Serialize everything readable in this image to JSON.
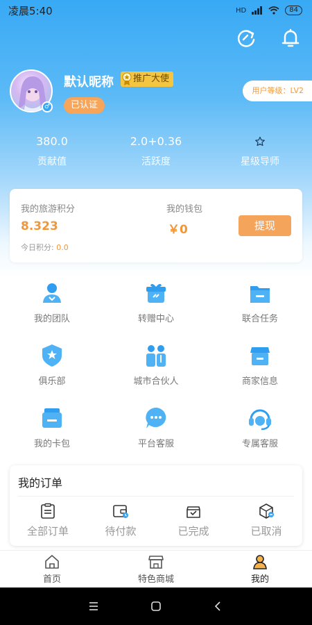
{
  "status_bar": {
    "time": "凌晨5:40",
    "network": "HD",
    "battery": "84"
  },
  "profile": {
    "nickname": "默认昵称",
    "badge": "推广大使",
    "verified": "已认证",
    "level": "用户等级：LV2"
  },
  "stats": [
    {
      "value": "380.0",
      "label": "贡献值"
    },
    {
      "value": "2.0+0.36",
      "label": "活跃度"
    },
    {
      "value": "",
      "label": "星级导师",
      "icon": "star-icon"
    }
  ],
  "points_card": {
    "points_label": "我的旅游积分",
    "points_value": "8.323",
    "wallet_label": "我的钱包",
    "wallet_value": "￥0",
    "today_label": "今日积分:",
    "today_value": "0.0",
    "withdraw_label": "提现"
  },
  "grid": [
    {
      "label": "我的团队",
      "icon": "team-icon"
    },
    {
      "label": "转赠中心",
      "icon": "gift-icon"
    },
    {
      "label": "联合任务",
      "icon": "folder-icon"
    },
    {
      "label": "俱乐部",
      "icon": "shield-star-icon"
    },
    {
      "label": "城市合伙人",
      "icon": "partners-icon"
    },
    {
      "label": "商家信息",
      "icon": "store-icon"
    },
    {
      "label": "我的卡包",
      "icon": "card-wallet-icon"
    },
    {
      "label": "平台客服",
      "icon": "chat-icon"
    },
    {
      "label": "专属客服",
      "icon": "headset-icon"
    }
  ],
  "orders": {
    "title": "我的订单",
    "items": [
      {
        "label": "全部订单",
        "icon": "clipboard-icon"
      },
      {
        "label": "待付款",
        "icon": "wallet-clock-icon"
      },
      {
        "label": "已完成",
        "icon": "box-check-icon"
      },
      {
        "label": "已取消",
        "icon": "box-cancel-icon"
      }
    ]
  },
  "tabbar": [
    {
      "label": "首页",
      "icon": "home-icon",
      "active": false
    },
    {
      "label": "特色商城",
      "icon": "shop-icon",
      "active": false
    },
    {
      "label": "我的",
      "icon": "user-icon",
      "active": true
    }
  ],
  "colors": {
    "primary": "#3aa4f0",
    "accent": "#f2963a",
    "badge": "#f4c540"
  }
}
